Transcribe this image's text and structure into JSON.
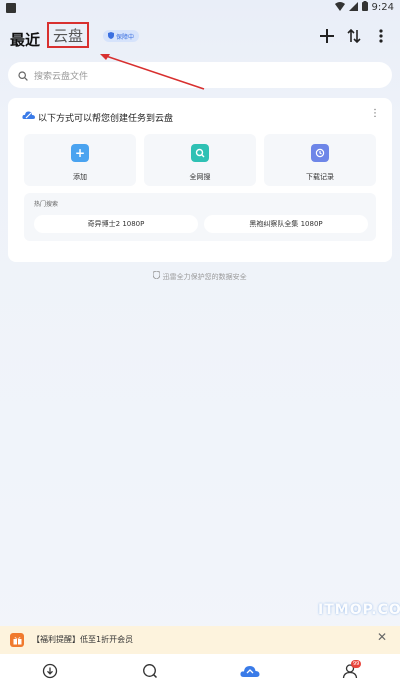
{
  "status_bar": {
    "time": "9:24"
  },
  "header": {
    "tab_recent": "最近",
    "tab_cloud": "云盘",
    "protect_badge": "保障中"
  },
  "search": {
    "placeholder": "搜索云盘文件"
  },
  "card": {
    "title": "以下方式可以帮您创建任务到云盘",
    "actions": [
      {
        "label": "添加",
        "icon": "plus-icon",
        "color": "#4aa3f0"
      },
      {
        "label": "全网搜",
        "icon": "search-icon",
        "color": "#2fc1b4"
      },
      {
        "label": "下载记录",
        "icon": "history-icon",
        "color": "#6e86e8"
      }
    ],
    "hot_title": "热门搜索",
    "hot_items": [
      "奇异博士2 1080P",
      "黑袍纠察队全集 1080P"
    ]
  },
  "safe_note": "迅雷全力保护您的数据安全",
  "promo": {
    "text": "【福利提醒】低至1折开会员"
  },
  "watermark": "ITMOP.COM",
  "nav": {
    "items": [
      "download-icon",
      "discover-icon",
      "cloud-icon",
      "profile-icon"
    ],
    "badge": "99",
    "active_color": "#3a7be8"
  }
}
